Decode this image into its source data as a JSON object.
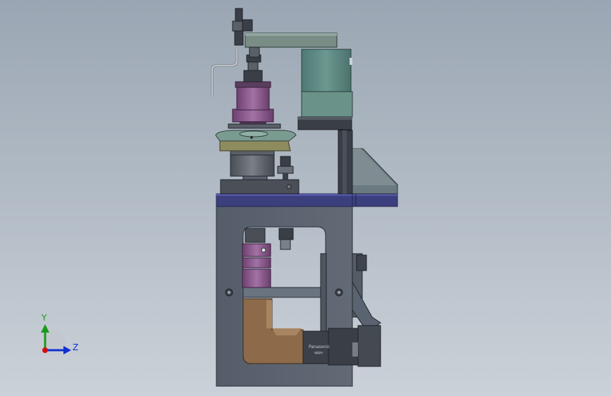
{
  "triad": {
    "y_label": "Y",
    "z_label": "Z",
    "x_color": "#d01010",
    "y_color": "#1a9a1a",
    "z_color": "#1030d0"
  },
  "motor_label": {
    "line1": "Panasonic",
    "line2": "apps"
  },
  "colors": {
    "frame": "#5c6470",
    "plate": "#3c3f7e",
    "plate_edge": "#5658a8",
    "teal": "#5e8a82",
    "magenta": "#8e5a8e",
    "bracket": "#6b7a80",
    "gearbox": "#8c6a4a",
    "dark": "#3a3e46"
  }
}
